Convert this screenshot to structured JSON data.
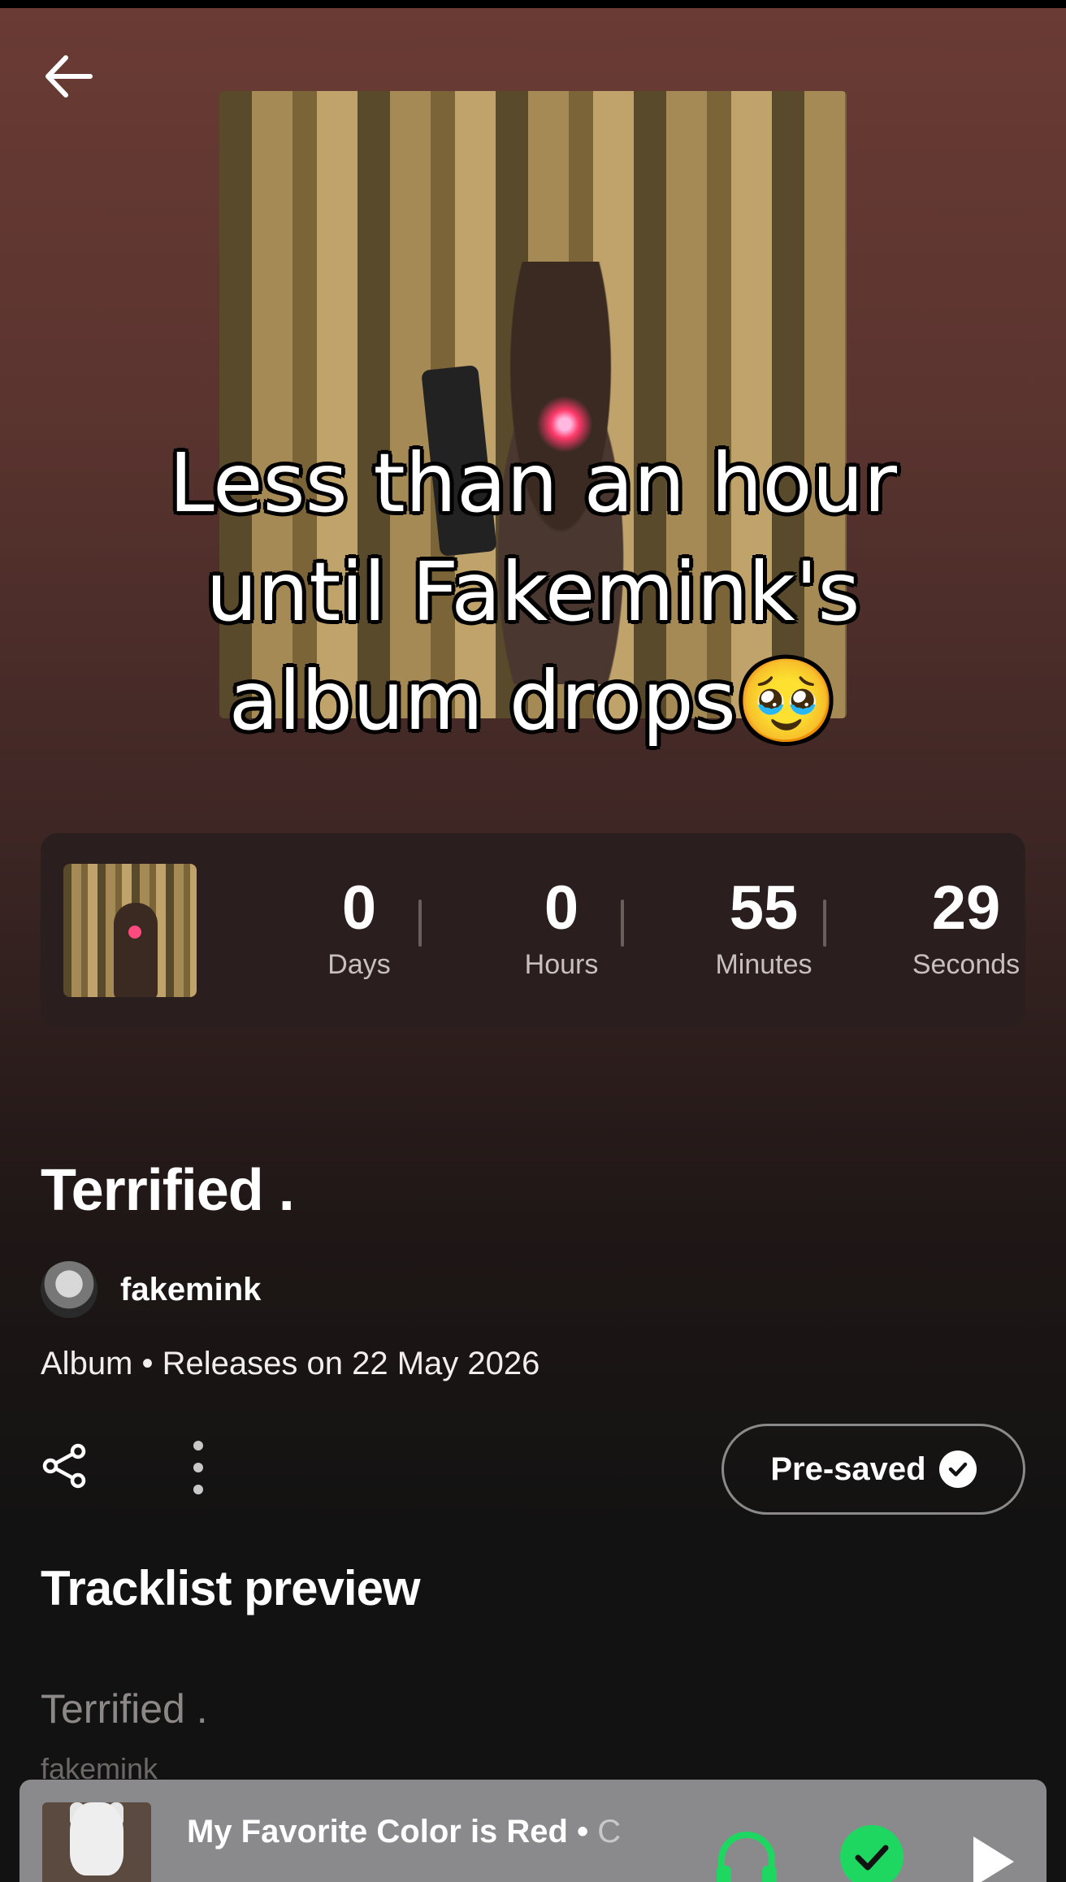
{
  "header": {
    "back_icon": "arrow-left-icon"
  },
  "overlay": {
    "caption": "Less than an hour\nuntil Fakemink's\nalbum drops🥹"
  },
  "countdown": {
    "days_value": "0",
    "days_label": "Days",
    "hours_value": "0",
    "hours_label": "Hours",
    "minutes_value": "55",
    "minutes_label": "Minutes",
    "seconds_value": "29",
    "seconds_label": "Seconds"
  },
  "album": {
    "title": "Terrified .",
    "artist": "fakemink",
    "meta": "Album • Releases on 22 May 2026"
  },
  "actions": {
    "share_icon": "share-icon",
    "more_icon": "more-vertical-icon",
    "presave_label": "Pre-saved",
    "presave_icon": "check-circle-icon"
  },
  "tracklist": {
    "heading": "Tracklist preview",
    "tracks": [
      {
        "title": "Terrified .",
        "artist": "fakemink"
      }
    ]
  },
  "now_playing": {
    "title": "My Favorite Color is Red",
    "separator": " • ",
    "subtitle_fragment": "C",
    "device_icon": "headphones-icon",
    "saved_icon": "check-circle-icon",
    "play_icon": "play-icon",
    "accent_color": "#1ed760"
  },
  "colors": {
    "background_top": "#6a3b34",
    "background_bottom": "#121212",
    "card": "#2a1f1e"
  }
}
